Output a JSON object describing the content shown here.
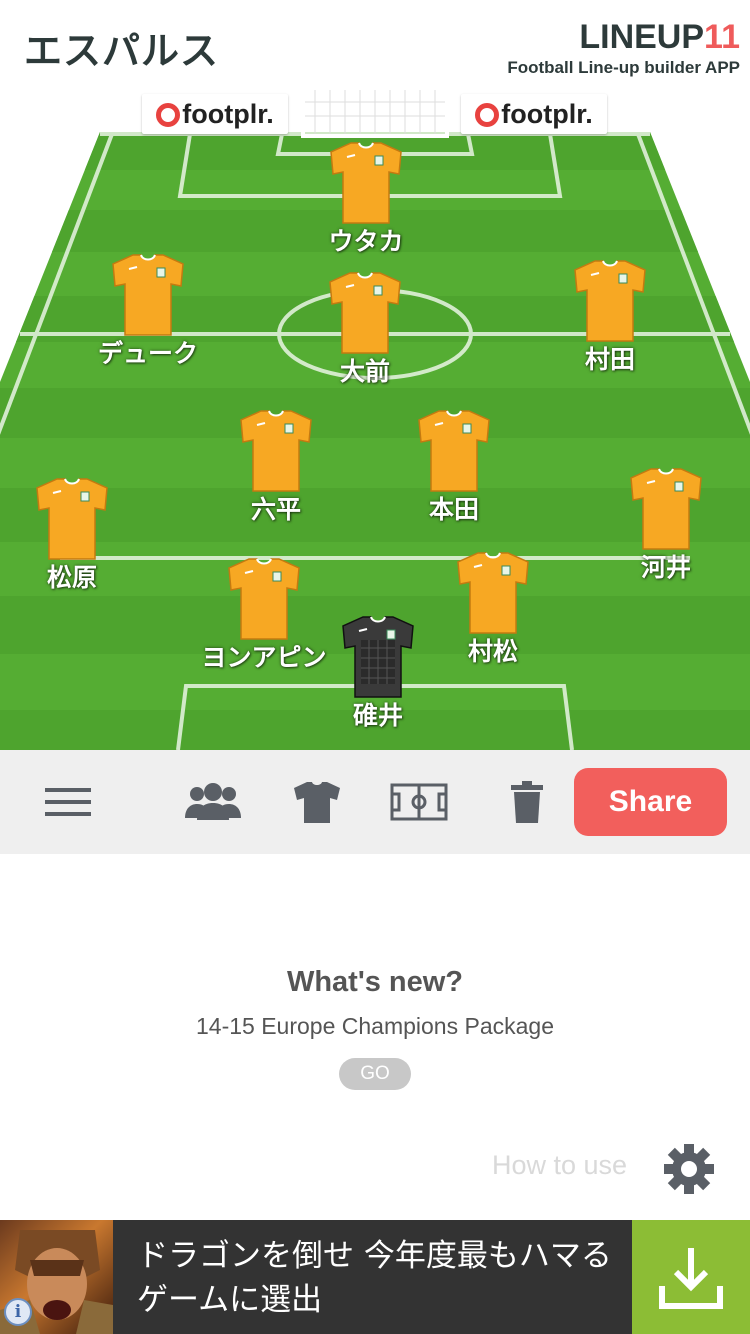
{
  "header": {
    "team_name": "エスパルス",
    "brand_prefix": "LINEUP",
    "brand_number": "11",
    "brand_subtitle": "Football Line-up builder APP"
  },
  "sponsors": [
    {
      "label": "footplr."
    },
    {
      "label": "footplr."
    }
  ],
  "colors": {
    "accent": "#f25f5c",
    "shirt_outfield": "#f7a823",
    "shirt_goalkeeper": "#3a3a3a",
    "pitch_light": "#5fb83a",
    "pitch_dark": "#4aa52c",
    "download": "#8cbd35"
  },
  "players": [
    {
      "name": "ウタカ",
      "role": "outfield"
    },
    {
      "name": "デューク",
      "role": "outfield"
    },
    {
      "name": "大前",
      "role": "outfield"
    },
    {
      "name": "村田",
      "role": "outfield"
    },
    {
      "name": "六平",
      "role": "outfield"
    },
    {
      "name": "本田",
      "role": "outfield"
    },
    {
      "name": "松原",
      "role": "outfield"
    },
    {
      "name": "河井",
      "role": "outfield"
    },
    {
      "name": "ヨンアピン",
      "role": "outfield"
    },
    {
      "name": "村松",
      "role": "outfield"
    },
    {
      "name": "碓井",
      "role": "goalkeeper"
    }
  ],
  "toolbar": {
    "menu_icon": "menu-icon",
    "players_icon": "players-icon",
    "shirt_icon": "shirt-icon",
    "field_icon": "field-icon",
    "trash_icon": "trash-icon",
    "share_label": "Share"
  },
  "whats_new": {
    "title": "What's new?",
    "subtitle": "14-15 Europe Champions Package",
    "go_label": "GO"
  },
  "how_to_use": {
    "label": "How to use",
    "icon": "gear-icon"
  },
  "ad": {
    "text": "ドラゴンを倒せ 今年度最もハマるゲームに選出",
    "download_icon": "download-icon",
    "info_icon": "info-icon",
    "info_label": "i"
  }
}
